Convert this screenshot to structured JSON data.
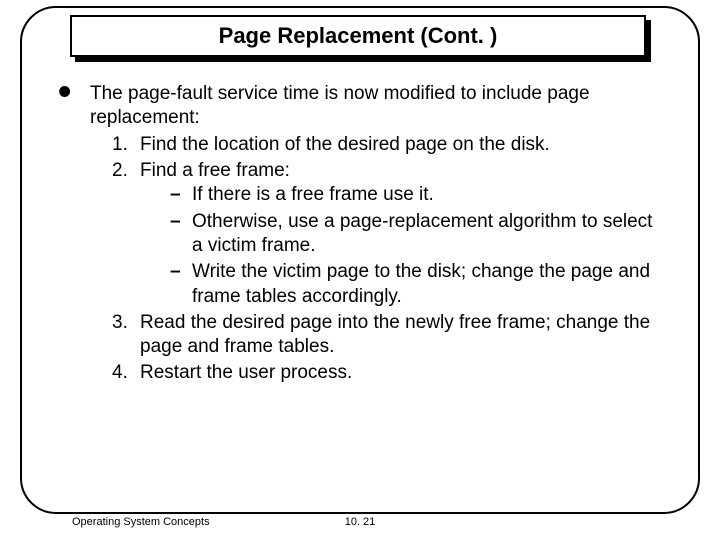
{
  "title": "Page Replacement (Cont. )",
  "lead": "The page-fault service time is now modified to include page replacement:",
  "steps": [
    {
      "num": "1.",
      "text": "Find the location of the desired page on the disk."
    },
    {
      "num": "2.",
      "text": "Find a free frame:"
    },
    {
      "num": "3.",
      "text": "Read the desired page into the newly free frame; change the page and frame tables."
    },
    {
      "num": "4.",
      "text": "Restart the user process."
    }
  ],
  "sub2": [
    "If there is a free frame use it.",
    "Otherwise, use a page-replacement algorithm to select a victim frame.",
    "Write the victim page to the disk; change the page and frame tables accordingly."
  ],
  "footer": {
    "left": "Operating System Concepts",
    "center": "10. 21"
  }
}
